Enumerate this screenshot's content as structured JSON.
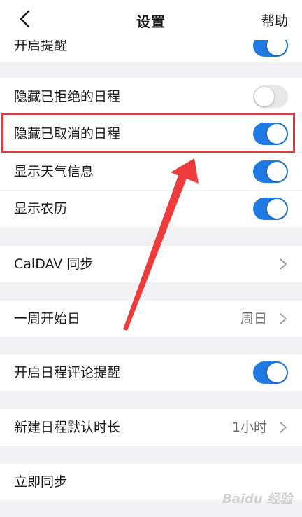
{
  "header": {
    "title": "设置",
    "help_label": "帮助",
    "back_icon": "chevron-left-icon"
  },
  "rows": {
    "reminder": {
      "label": "开启提醒",
      "toggle": true
    },
    "hide_declined": {
      "label": "隐藏已拒绝的日程",
      "toggle": false
    },
    "hide_cancelled": {
      "label": "隐藏已取消的日程",
      "toggle": true
    },
    "show_weather": {
      "label": "显示天气信息",
      "toggle": true
    },
    "show_lunar": {
      "label": "显示农历",
      "toggle": true
    },
    "caldav": {
      "label": "CalDAV 同步"
    },
    "week_start": {
      "label": "一周开始日",
      "value": "周日"
    },
    "comment_reminder": {
      "label": "开启日程评论提醒",
      "toggle": true
    },
    "default_duration": {
      "label": "新建日程默认时长",
      "value": "1小时"
    },
    "sync_now": {
      "label": "立即同步"
    }
  },
  "watermark": "Baidu 经验",
  "colors": {
    "toggle_on": "#1f7ae3",
    "toggle_off": "#e7e7ea",
    "highlight": "#e23a3a",
    "background": "#f2f2f4"
  }
}
